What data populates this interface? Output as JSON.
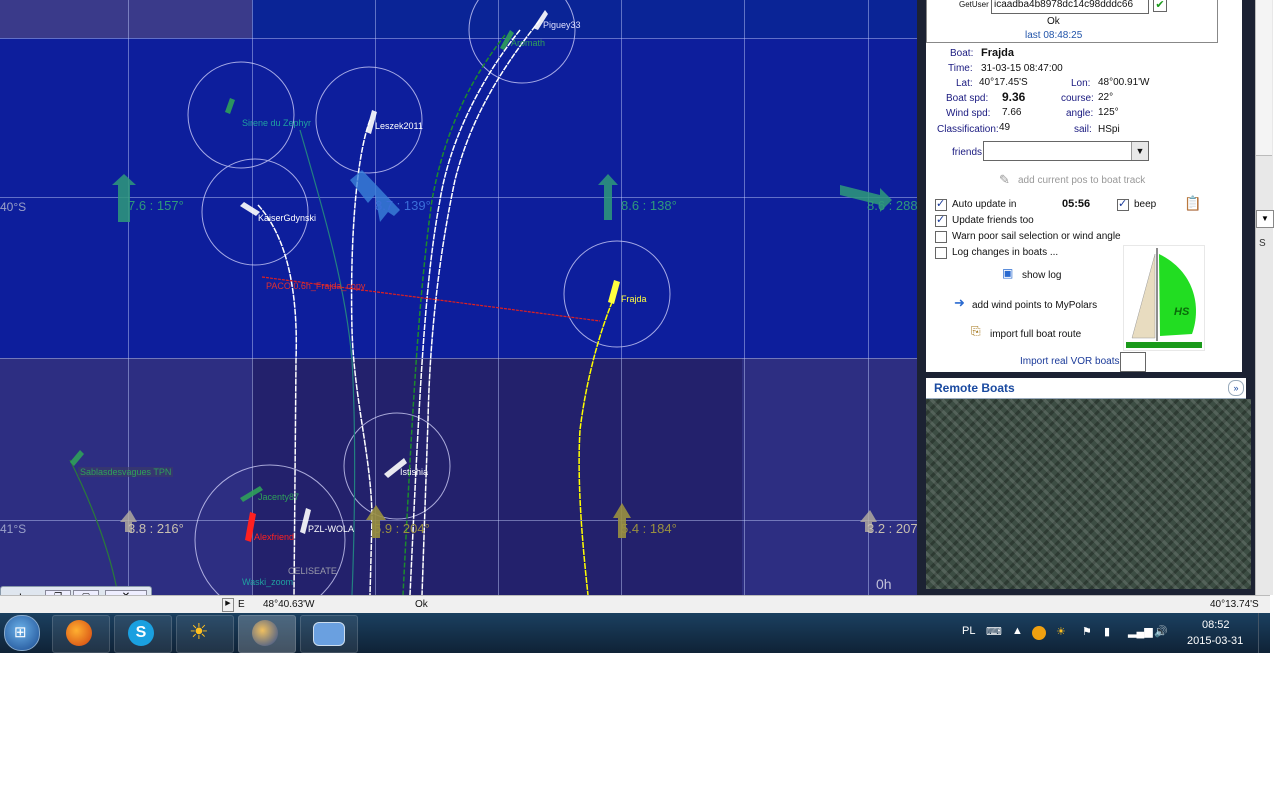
{
  "map": {
    "wind_labels": [
      {
        "text": "7.6 : 157°"
      },
      {
        "text": "8.7 : 139°"
      },
      {
        "text": "8.6 : 138°"
      },
      {
        "text": "8.6 : 288"
      },
      {
        "text": "3.8 : 216°"
      },
      {
        "text": "5.9 : 204°"
      },
      {
        "text": "5.4 : 184°"
      },
      {
        "text": "3.2 : 207"
      }
    ],
    "lat_labels": [
      "40°S",
      "41°S"
    ],
    "boats": [
      "Piguey33",
      "Aromath",
      "Sirene du Zephyr",
      "Leszek2011",
      "KaiserGdynski",
      "Frajda",
      "Istishia",
      "Sablasdesvagues TPN",
      "Jacenty87",
      "Alexfriend",
      "PZL-WOLA",
      "Waski_zoom",
      "CELISEATE"
    ],
    "track_label": "PACO 0.6h_Frajda_copy",
    "time_label": "0h"
  },
  "panel": {
    "getuser_label": "GetUser",
    "getuser_value": "icaadba4b8978dc14c98dddc66",
    "ok": "Ok",
    "last": "last 08:48:25",
    "boat_label": "Boat:",
    "boat_value": "Frajda",
    "time_label": "Time:",
    "time_value": "31-03-15 08:47:00",
    "lat_label": "Lat:",
    "lat_value": "40°17.45'S",
    "lon_label": "Lon:",
    "lon_value": "48°00.91'W",
    "boat_spd_label": "Boat spd:",
    "boat_spd_value": "9.36",
    "course_label": "course:",
    "course_value": "22°",
    "wind_spd_label": "Wind   spd:",
    "wind_spd_value": "7.66",
    "angle_label": "angle:",
    "angle_value": "125°",
    "class_label": "Classification:",
    "class_value": "49",
    "sail_label": "sail:",
    "sail_value": "HSpi",
    "friends_label": "friends",
    "add_pos": "add current pos to boat track",
    "auto_update": "Auto update in",
    "countdown": "05:56",
    "beep": "beep",
    "update_friends": "Update friends too",
    "warn_sail": "Warn poor sail selection or wind angle",
    "log_changes": "Log changes in boats ...",
    "show_log": "show log",
    "add_wind": "add wind points to MyPolars",
    "import_route": "import full boat route",
    "import_vor": "Import real VOR boats",
    "sail_badge": "HS",
    "remote_boats": "Remote Boats",
    "side_s": "S"
  },
  "statusbar": {
    "e": "E",
    "lon": "48°40.63'W",
    "ok": "Ok",
    "lat": "40°13.74'S"
  },
  "mini_window": {
    "title": "L."
  },
  "taskbar": {
    "lang": "PL",
    "time": "08:52",
    "date": "2015-03-31"
  }
}
